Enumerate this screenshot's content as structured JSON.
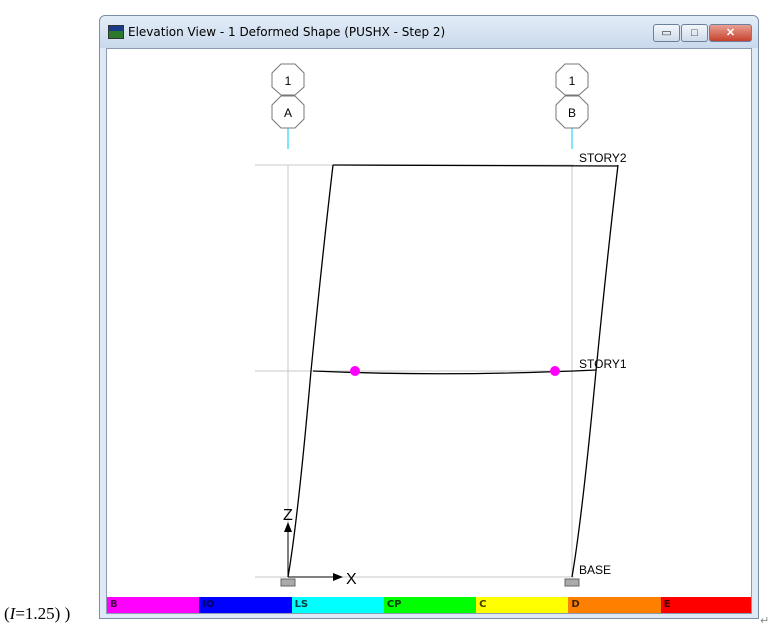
{
  "window": {
    "title": "Elevation View - 1  Deformed Shape (PUSHX - Step 2)",
    "minimize_glyph": "▭",
    "maximize_glyph": "□",
    "close_glyph": "✕"
  },
  "grid": {
    "bubbles": [
      {
        "top": "1",
        "bottom": "A"
      },
      {
        "top": "1",
        "bottom": "B"
      }
    ],
    "levels": [
      "STORY2",
      "STORY1",
      "BASE"
    ]
  },
  "axes": {
    "z_label": "Z",
    "x_label": "X"
  },
  "legend": [
    {
      "label": "B",
      "color": "#ff00ff",
      "text_color": "#400040"
    },
    {
      "label": "IO",
      "color": "#0000ff",
      "text_color": "#000060"
    },
    {
      "label": "LS",
      "color": "#00ffff",
      "text_color": "#004040"
    },
    {
      "label": "CP",
      "color": "#00ff00",
      "text_color": "#004000"
    },
    {
      "label": "C",
      "color": "#ffff00",
      "text_color": "#404000"
    },
    {
      "label": "D",
      "color": "#ff8000",
      "text_color": "#402000"
    },
    {
      "label": "E",
      "color": "#ff0000",
      "text_color": "#400000"
    }
  ],
  "caption": {
    "prefix": "(",
    "variable": "I",
    "rest": "=1.25) )"
  },
  "colors": {
    "hinge": "#ff00ff",
    "grid_line": "#c8c8c8",
    "bubble_stem": "#00ccff"
  }
}
